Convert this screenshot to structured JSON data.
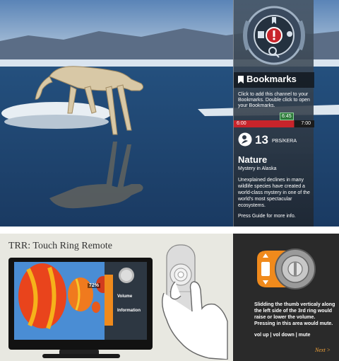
{
  "top_panel": {
    "bookmarks": {
      "title": "Bookmarks",
      "description": "Click to add this channel to your Bookmarks.  Double click to open your Bookmarks."
    },
    "timeline": {
      "current_time": "6:45",
      "start": "6:00",
      "end": "7:00",
      "progress": 0.75
    },
    "channel": {
      "number": "13",
      "network": "PBS/KERA"
    },
    "program": {
      "title": "Nature",
      "subtitle": "Mystery in Alaska",
      "description": "Unexplained declines in many wildlife species have created a world-class mystery in one of the world's most spectacular ecosystems.",
      "guide_hint": "Press Guide for more info."
    }
  },
  "bottom_left": {
    "title": "TRR: Touch Ring Remote",
    "tv": {
      "volume_readout": "72%",
      "menu_items": [
        "Volume",
        "Information"
      ]
    }
  },
  "bottom_right": {
    "description": "Slidding the thumb verticaly along the left side of the 3rd ring would raise or lower the volume. Pressing in this area would mute.",
    "actions": "vol up | vol down | mute",
    "next_label": "Next >"
  },
  "colors": {
    "accent_orange": "#f08a1c",
    "bookmark_red": "#c8242b",
    "panel_bg": "#2a2a2a"
  }
}
